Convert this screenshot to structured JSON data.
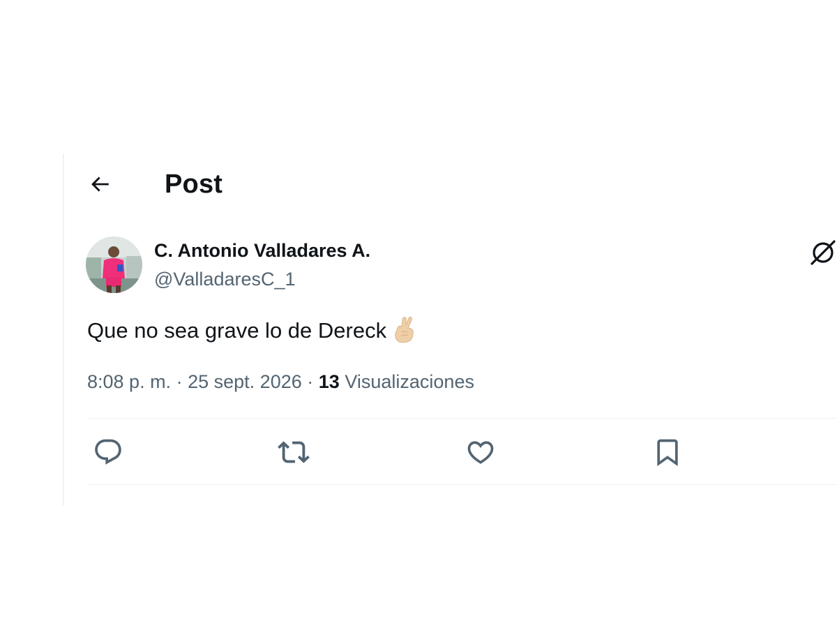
{
  "header": {
    "title": "Post",
    "back_icon": "arrow-left-icon"
  },
  "tweet": {
    "author": {
      "display_name": "C. Antonio Valladares A.",
      "handle": "@ValladaresC_1",
      "avatar": "profile-photo-person-in-pink-jersey"
    },
    "text": "Que no sea grave lo de Dereck",
    "emoji": "crossed-fingers-emoji",
    "time": "8:08 p. m.",
    "separator": "·",
    "date": "25 sept. 2026",
    "views_count": "13",
    "views_label": "Visualizaciones"
  },
  "actions": [
    "reply-icon",
    "repost-icon",
    "like-icon",
    "bookmark-icon"
  ],
  "top_right_icon": "grok-icon",
  "colors": {
    "text": "#0f1419",
    "secondary": "#536471",
    "divider": "#eff3f4"
  }
}
